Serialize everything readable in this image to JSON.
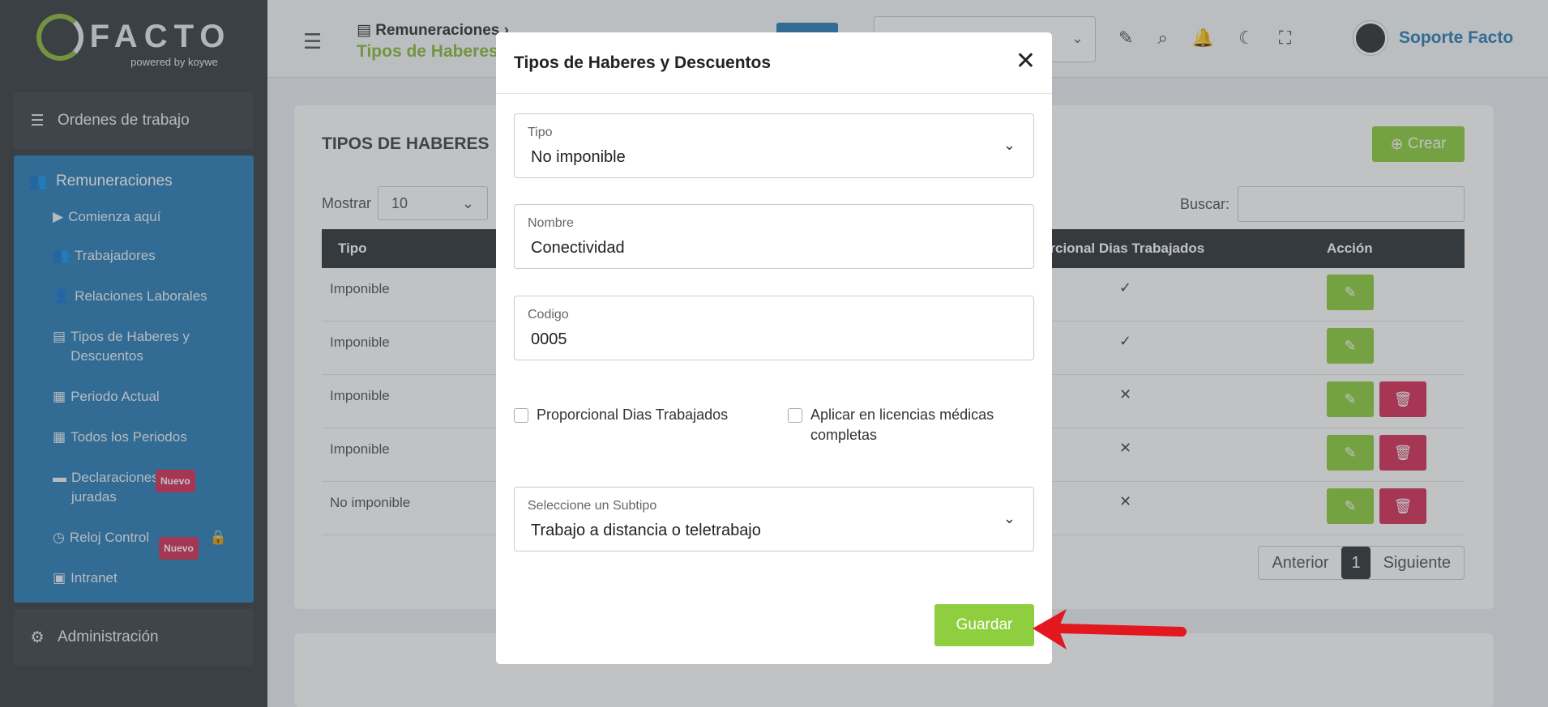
{
  "sidebar": {
    "logo_text": "FACTO",
    "logo_sub": "powered by koywe",
    "ordenes": "Ordenes de trabajo",
    "remuneraciones": "Remuneraciones",
    "items": [
      {
        "label": "Comienza aquí"
      },
      {
        "label": "Trabajadores"
      },
      {
        "label": "Relaciones Laborales"
      },
      {
        "label": "Tipos de Haberes y Descuentos"
      },
      {
        "label": "Periodo Actual"
      },
      {
        "label": "Todos los Periodos"
      },
      {
        "label": "Declaraciones juradas",
        "badge": "Nuevo"
      },
      {
        "label": "Reloj Control",
        "badge": "Nuevo"
      },
      {
        "label": "Intranet"
      }
    ],
    "administracion": "Administración"
  },
  "topbar": {
    "breadcrumb_parent": "Remuneraciones",
    "breadcrumb_current": "Tipos de Haberes",
    "user_name": "Soporte Facto"
  },
  "card": {
    "title": "TIPOS DE HABERES",
    "crear": "Crear",
    "mostrar": "Mostrar",
    "mostrar_value": "10",
    "buscar": "Buscar:",
    "columns": {
      "tipo": "Tipo",
      "proporcional": "orcional Dias Trabajados",
      "accion": "Acción"
    },
    "rows": [
      {
        "tipo": "Imponible",
        "mark": "✓"
      },
      {
        "tipo": "Imponible",
        "mark": "✓"
      },
      {
        "tipo": "Imponible",
        "mark": "✕"
      },
      {
        "tipo": "Imponible",
        "mark": "✕"
      },
      {
        "tipo": "No imponible",
        "mark": "✕"
      }
    ],
    "pager": {
      "prev": "Anterior",
      "current": "1",
      "next": "Siguiente"
    }
  },
  "modal": {
    "title": "Tipos de Haberes y Descuentos",
    "tipo_label": "Tipo",
    "tipo_value": "No imponible",
    "nombre_label": "Nombre",
    "nombre_value": "Conectividad",
    "codigo_label": "Codigo",
    "codigo_value": "0005",
    "chk_proporcional": "Proporcional Dias Trabajados",
    "chk_licencias": "Aplicar en licencias médicas completas",
    "subtipo_label": "Seleccione un Subtipo",
    "subtipo_value": "Trabajo a distancia o teletrabajo",
    "guardar": "Guardar"
  },
  "colors": {
    "accent_green": "#8fcf3f",
    "accent_blue": "#2f7fb7",
    "danger": "#d9335a"
  }
}
